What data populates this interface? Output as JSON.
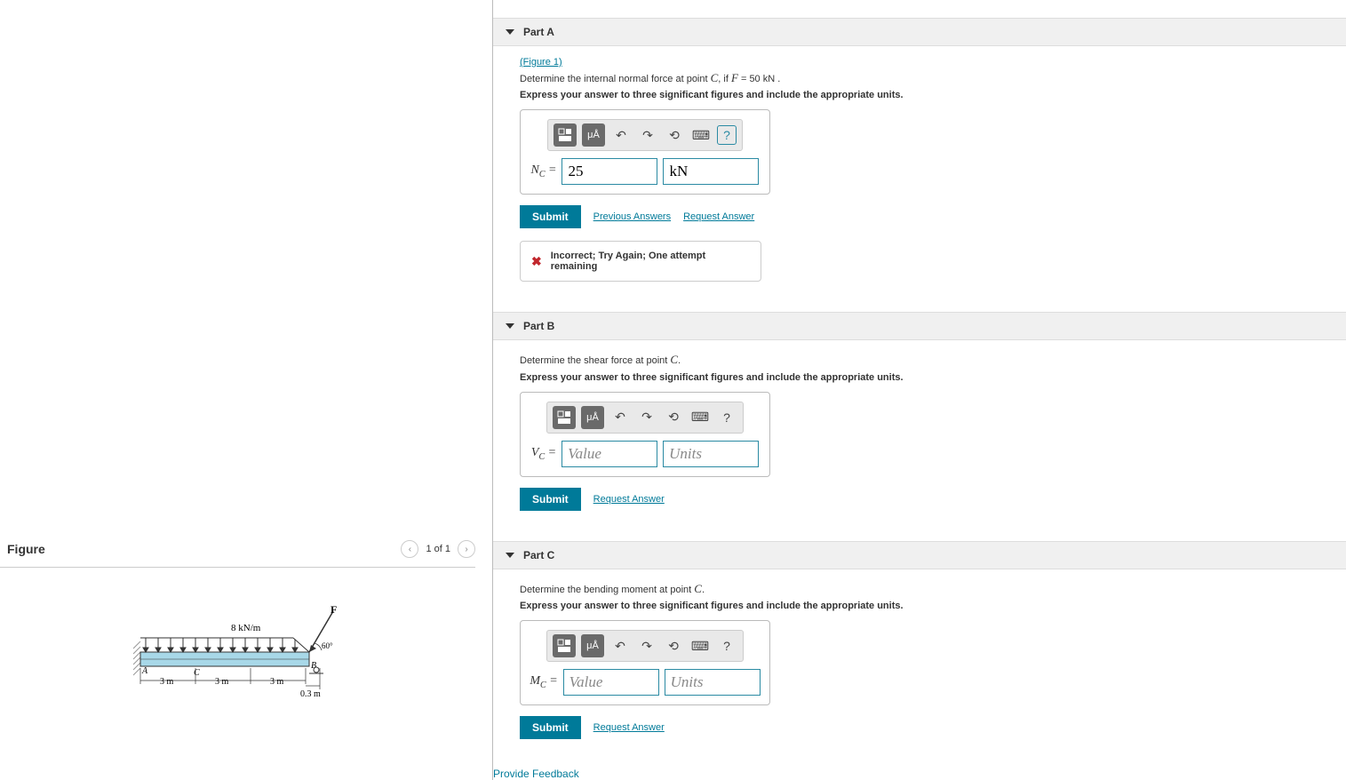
{
  "figure": {
    "title": "Figure",
    "pager": "1 of 1",
    "diagram": {
      "load_label": "8 kN/m",
      "force_label": "F",
      "angle_label": "60°",
      "point_a": "A",
      "point_b": "B",
      "point_c": "C",
      "dim1": "3 m",
      "dim2": "3 m",
      "dim3": "3 m",
      "dim4": "0.3 m"
    }
  },
  "partA": {
    "title": "Part A",
    "figlink": "(Figure 1)",
    "prompt_pre": "Determine the internal normal force at point ",
    "prompt_var1": "C",
    "prompt_mid": ", if ",
    "prompt_var2": "F",
    "prompt_val": " = 50 kN .",
    "instruction": "Express your answer to three significant figures and include the appropriate units.",
    "var_symbol": "N",
    "var_sub": "C",
    "value": "25",
    "units": "kN",
    "submit": "Submit",
    "prev_link": "Previous Answers",
    "req_link": "Request Answer",
    "feedback": "Incorrect; Try Again; One attempt remaining"
  },
  "partB": {
    "title": "Part B",
    "prompt_pre": "Determine the shear force at point ",
    "prompt_var1": "C",
    "prompt_post": ".",
    "instruction": "Express your answer to three significant figures and include the appropriate units.",
    "var_symbol": "V",
    "var_sub": "C",
    "value_ph": "Value",
    "units_ph": "Units",
    "submit": "Submit",
    "req_link": "Request Answer"
  },
  "partC": {
    "title": "Part C",
    "prompt_pre": "Determine the bending moment at point ",
    "prompt_var1": "C",
    "prompt_post": ".",
    "instruction": "Express your answer to three significant figures and include the appropriate units.",
    "var_symbol": "M",
    "var_sub": "C",
    "value_ph": "Value",
    "units_ph": "Units",
    "submit": "Submit",
    "req_link": "Request Answer"
  },
  "toolbar": {
    "special_label": "μÅ"
  },
  "footer": {
    "provide_feedback": "Provide Feedback"
  }
}
